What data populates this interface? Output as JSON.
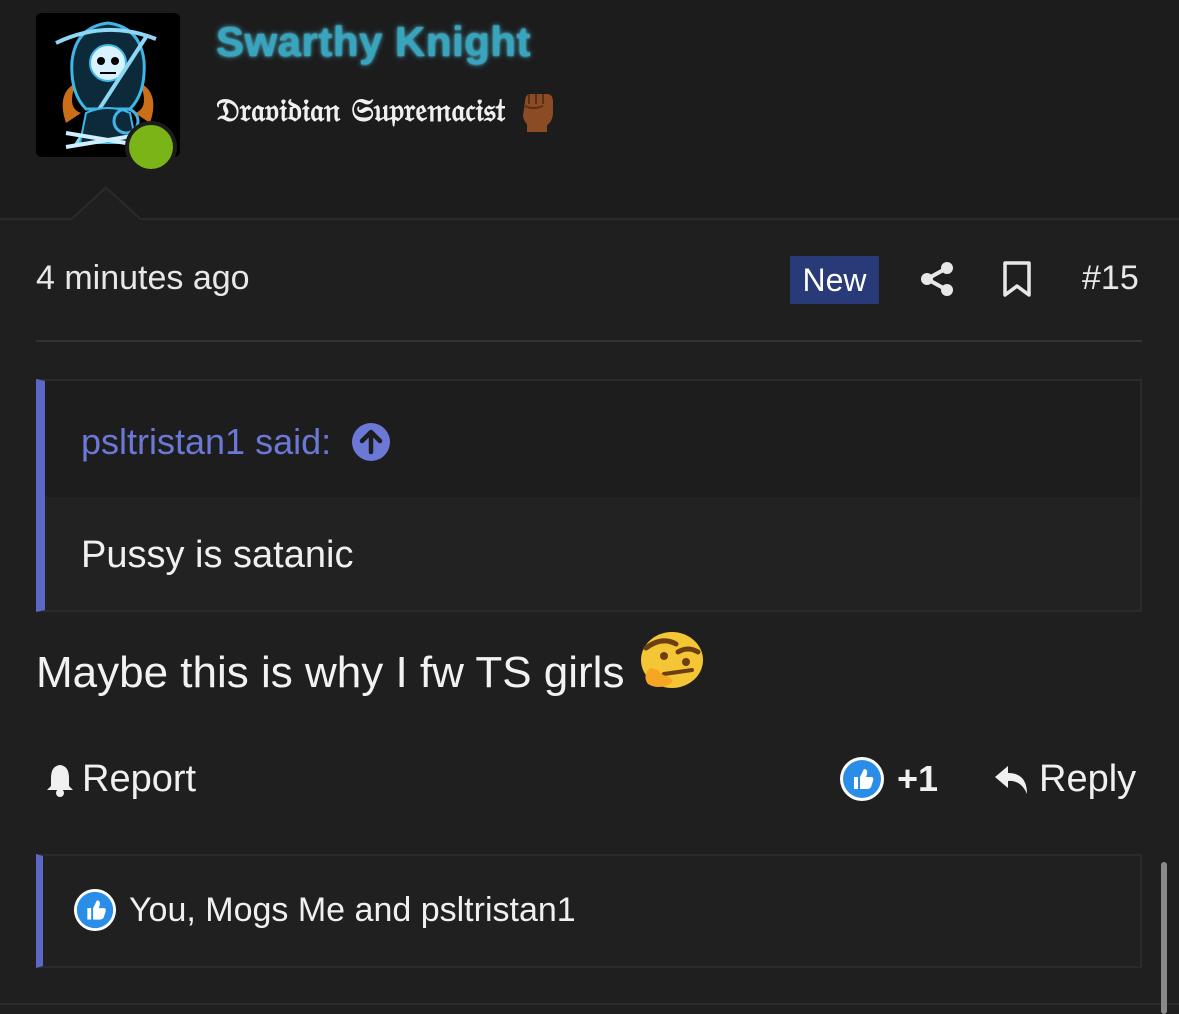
{
  "author": {
    "username": "Swarthy Knight",
    "user_title": "𝔇𝔯𝔞𝔳𝔦𝔡𝔦𝔞𝔫 𝔖𝔲𝔭𝔯𝔢𝔪𝔞𝔠𝔦𝔰𝔱",
    "title_emoji": "raised-fist-medium-dark-skin",
    "online_status": "online",
    "username_color": "#37a5bd",
    "online_color": "#7bb416"
  },
  "meta": {
    "time": "4 minutes ago",
    "new_badge": "New",
    "post_number": "#15",
    "share_icon": "share-icon",
    "bookmark_icon": "bookmark-icon"
  },
  "quote": {
    "author_line": "psltristan1 said:",
    "body": "Pussy is satanic",
    "accent_color": "#5b68c8"
  },
  "message": {
    "text": "Maybe this is why I fw TS girls",
    "emoji": "thinking-face-emoji"
  },
  "actions": {
    "report_label": "Report",
    "reaction_count": "+1",
    "reply_label": "Reply"
  },
  "reactions": {
    "summary": "You, Mogs Me and psltristan1",
    "icon": "like-icon"
  }
}
